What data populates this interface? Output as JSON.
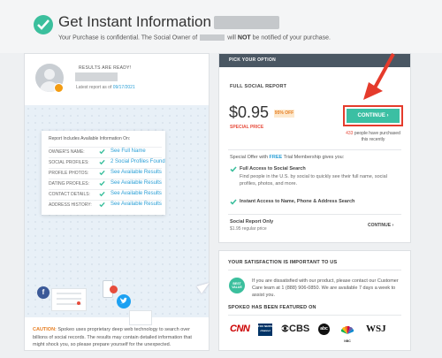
{
  "header": {
    "title": "Get Instant Information on",
    "subtitle_pre": "Your Purchase is confidential. The Social Owner of",
    "subtitle_mid": "will",
    "subtitle_not": "NOT",
    "subtitle_post": "be notified of your purchase."
  },
  "profile": {
    "ready": "RESULTS ARE READY!",
    "updated_label": "Latest report as of",
    "updated_date": "09/17/2021"
  },
  "report": {
    "title": "Report Includes Available Information On:",
    "rows": [
      {
        "label": "OWNER'S NAME:",
        "value": "See Full Name"
      },
      {
        "label": "SOCIAL PROFILES:",
        "value": "2 Social Profiles Found"
      },
      {
        "label": "PROFILE PHOTOS:",
        "value": "See Available Results"
      },
      {
        "label": "DATING PROFILES:",
        "value": "See Available Results"
      },
      {
        "label": "CONTACT DETAILS:",
        "value": "See Available Results"
      },
      {
        "label": "ADDRESS HISTORY:",
        "value": "See Available Results"
      }
    ]
  },
  "caution": {
    "label": "CAUTION:",
    "text": "Spokeo uses proprietary deep web technology to search over billions of social records. The results may contain detailed information that might shock you, so please prepare yourself for the unexpected."
  },
  "option": {
    "header": "PICK YOUR OPTION",
    "plan": "FULL SOCIAL REPORT",
    "price": "$0.95",
    "discount": "95% OFF",
    "special": "SPECIAL PRICE",
    "continue": "CONTINUE",
    "people_count": "433",
    "people_text": "people have purchased this recently",
    "offer_pre": "Special Offer with",
    "offer_free": "FREE",
    "offer_post": "Trial Membership gives you:",
    "features": [
      {
        "title": "Full Access to Social Search",
        "desc": "Find people in the U.S. by social to quickly see their full name, social profiles, photos, and more."
      },
      {
        "title": "Instant Access to Name, Phone & Address Search",
        "desc": ""
      }
    ],
    "alt_plan": "Social Report Only",
    "alt_price": "$1.95 regular price",
    "alt_continue": "CONTINUE"
  },
  "satisfaction": {
    "title": "YOUR SATISFACTION IS IMPORTANT TO US",
    "badge": "BEST VALUE",
    "text": "If you are dissatisfied with our product, please contact our Customer Care team at 1 (888) 906-0850. We are available 7 days a week to assist you.",
    "featured": "SPOKEO HAS BEEN FEATURED ON",
    "logos": {
      "cnn": "CNN",
      "fox": "FOX NEWS channel",
      "cbs": "CBS",
      "abc": "abc",
      "nbc": "NBC",
      "wsj": "WSJ"
    }
  },
  "colors": {
    "accent": "#3bbf9d",
    "highlight": "#e53b2c",
    "link": "#2a9fd6"
  }
}
